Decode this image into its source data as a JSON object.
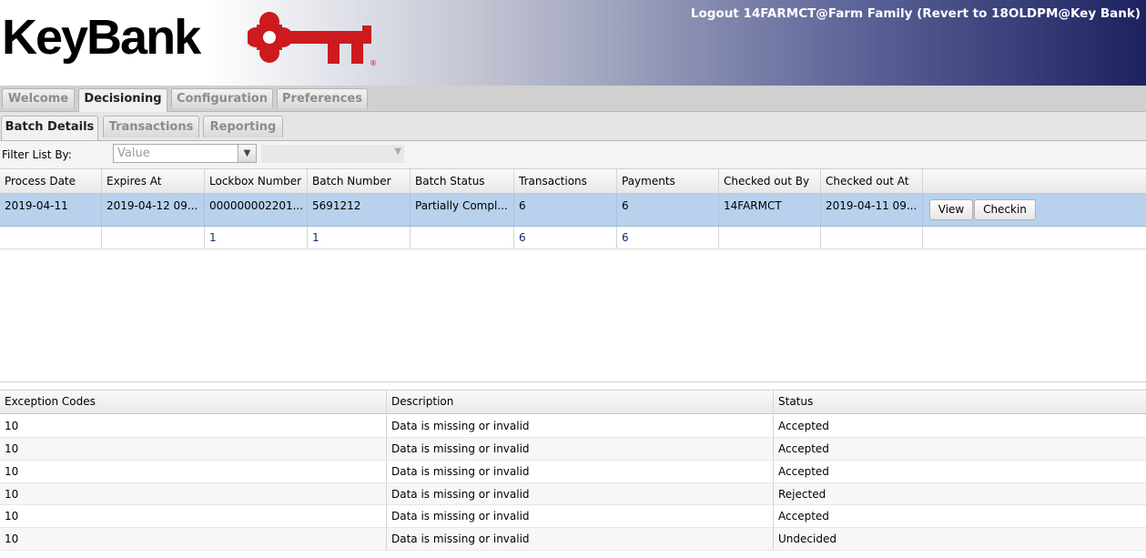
{
  "header": {
    "logo_text": "KeyBank",
    "logout_text": "Logout 14FARMCT@Farm Family (Revert to 18OLDPM@Key Bank)"
  },
  "main_tabs": [
    {
      "label": "Welcome",
      "active": false
    },
    {
      "label": "Decisioning",
      "active": true
    },
    {
      "label": "Configuration",
      "active": false
    },
    {
      "label": "Preferences",
      "active": false
    }
  ],
  "sub_tabs": [
    {
      "label": "Batch Details",
      "active": true
    },
    {
      "label": "Transactions",
      "active": false
    },
    {
      "label": "Reporting",
      "active": false
    }
  ],
  "filter": {
    "label": "Filter List By:",
    "select_value": "Value"
  },
  "batch_table": {
    "columns": [
      "Process Date",
      "Expires At",
      "Lockbox Number",
      "Batch Number",
      "Batch Status",
      "Transactions",
      "Payments",
      "Checked out By",
      "Checked out At"
    ],
    "rows": [
      [
        "2019-04-11",
        "2019-04-12 09...",
        "000000002201...",
        "5691212",
        "Partially Compl...",
        "6",
        "6",
        "14FARMCT",
        "2019-04-11 09..."
      ]
    ],
    "summary": [
      "",
      "",
      "1",
      "1",
      "",
      "6",
      "6",
      "",
      ""
    ],
    "view_label": "View",
    "checkin_label": "Checkin"
  },
  "exception_table": {
    "columns": [
      "Exception Codes",
      "Description",
      "Status"
    ],
    "rows": [
      [
        "10",
        "Data is missing or invalid",
        "Accepted"
      ],
      [
        "10",
        "Data is missing or invalid",
        "Accepted"
      ],
      [
        "10",
        "Data is missing or invalid",
        "Accepted"
      ],
      [
        "10",
        "Data is missing or invalid",
        "Rejected"
      ],
      [
        "10",
        "Data is missing or invalid",
        "Accepted"
      ],
      [
        "10",
        "Data is missing or invalid",
        "Undecided"
      ]
    ]
  },
  "colors": {
    "brand_red": "#cc1a1f",
    "header_navy": "#1d2260",
    "selected_row": "#b8d1ec"
  }
}
